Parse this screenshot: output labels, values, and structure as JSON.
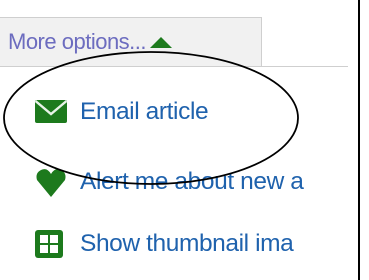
{
  "menu": {
    "more_options_label": "More options...",
    "more_options_icon": "triangle-up-icon",
    "items": [
      {
        "label": "Email article",
        "icon": "envelope-icon"
      },
      {
        "label": "Alert me about new a",
        "icon": "alert-heart-icon"
      },
      {
        "label": "Show thumbnail ima",
        "icon": "thumbnail-grid-icon"
      }
    ]
  },
  "colors": {
    "link": "#1f62ad",
    "more_options_text": "#6c6cbf",
    "icon_green": "#1d7a1d",
    "toolbar_bg": "#f1f1f1"
  }
}
